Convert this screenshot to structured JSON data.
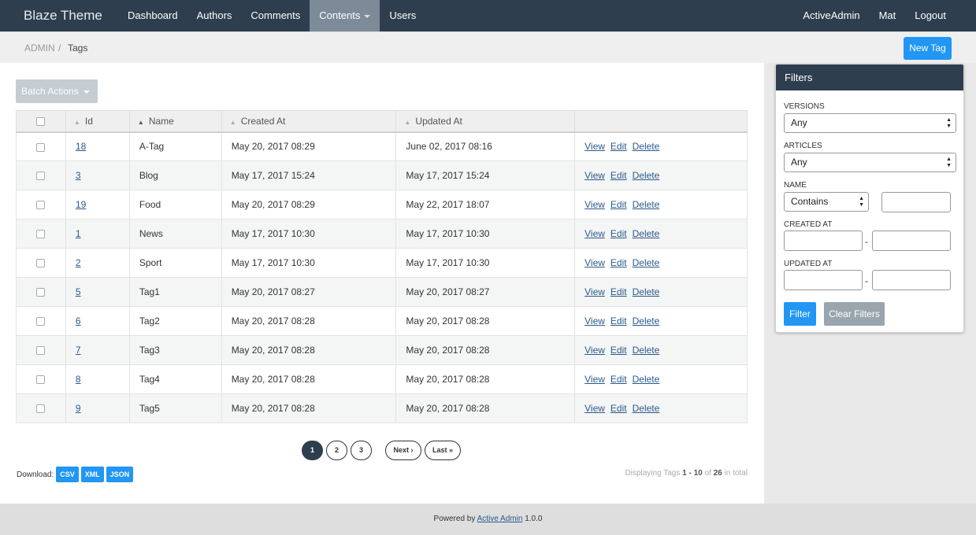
{
  "nav": {
    "brand": "Blaze Theme",
    "items": [
      {
        "label": "Dashboard"
      },
      {
        "label": "Authors"
      },
      {
        "label": "Comments"
      },
      {
        "label": "Contents"
      },
      {
        "label": "Users"
      }
    ],
    "right": [
      {
        "label": "ActiveAdmin"
      },
      {
        "label": "Mat"
      },
      {
        "label": "Logout"
      }
    ]
  },
  "breadcrumb": {
    "root": "ADMIN",
    "separator": "/",
    "title": "Tags"
  },
  "actions": {
    "new_label": "New Tag",
    "batch_label": "Batch Actions"
  },
  "table": {
    "headers": {
      "id": "Id",
      "name": "Name",
      "created": "Created At",
      "updated": "Updated At"
    },
    "row_actions": {
      "view": "View",
      "edit": "Edit",
      "delete": "Delete"
    },
    "rows": [
      {
        "id": "18",
        "name": "A-Tag",
        "created": "May 20, 2017 08:29",
        "updated": "June 02, 2017 08:16"
      },
      {
        "id": "3",
        "name": "Blog",
        "created": "May 17, 2017 15:24",
        "updated": "May 17, 2017 15:24"
      },
      {
        "id": "19",
        "name": "Food",
        "created": "May 20, 2017 08:29",
        "updated": "May 22, 2017 18:07"
      },
      {
        "id": "1",
        "name": "News",
        "created": "May 17, 2017 10:30",
        "updated": "May 17, 2017 10:30"
      },
      {
        "id": "2",
        "name": "Sport",
        "created": "May 17, 2017 10:30",
        "updated": "May 17, 2017 10:30"
      },
      {
        "id": "5",
        "name": "Tag1",
        "created": "May 20, 2017 08:27",
        "updated": "May 20, 2017 08:27"
      },
      {
        "id": "6",
        "name": "Tag2",
        "created": "May 20, 2017 08:28",
        "updated": "May 20, 2017 08:28"
      },
      {
        "id": "7",
        "name": "Tag3",
        "created": "May 20, 2017 08:28",
        "updated": "May 20, 2017 08:28"
      },
      {
        "id": "8",
        "name": "Tag4",
        "created": "May 20, 2017 08:28",
        "updated": "May 20, 2017 08:28"
      },
      {
        "id": "9",
        "name": "Tag5",
        "created": "May 20, 2017 08:28",
        "updated": "May 20, 2017 08:28"
      }
    ]
  },
  "pagination": {
    "pages": [
      "1",
      "2",
      "3"
    ],
    "current": "1",
    "next": "Next ›",
    "last": "Last »"
  },
  "download": {
    "label": "Download:",
    "formats": [
      "CSV",
      "XML",
      "JSON"
    ]
  },
  "displaying": {
    "prefix": "Displaying Tags",
    "range": "1 - 10",
    "of": "of",
    "total": "26",
    "suffix": "in total"
  },
  "footer": {
    "prefix": "Powered by",
    "link": "Active Admin",
    "version": "1.0.0"
  },
  "filters": {
    "title": "Filters",
    "versions_label": "Versions",
    "versions_value": "Any",
    "articles_label": "Articles",
    "articles_value": "Any",
    "name_label": "Name",
    "name_match": "Contains",
    "created_label": "Created At",
    "updated_label": "Updated At",
    "range_sep": "-",
    "filter_button": "Filter",
    "clear_button": "Clear Filters"
  },
  "colors": {
    "nav_bg": "#2e3e4f",
    "accent": "#2196f3",
    "disabled": "#9aa5ad"
  }
}
